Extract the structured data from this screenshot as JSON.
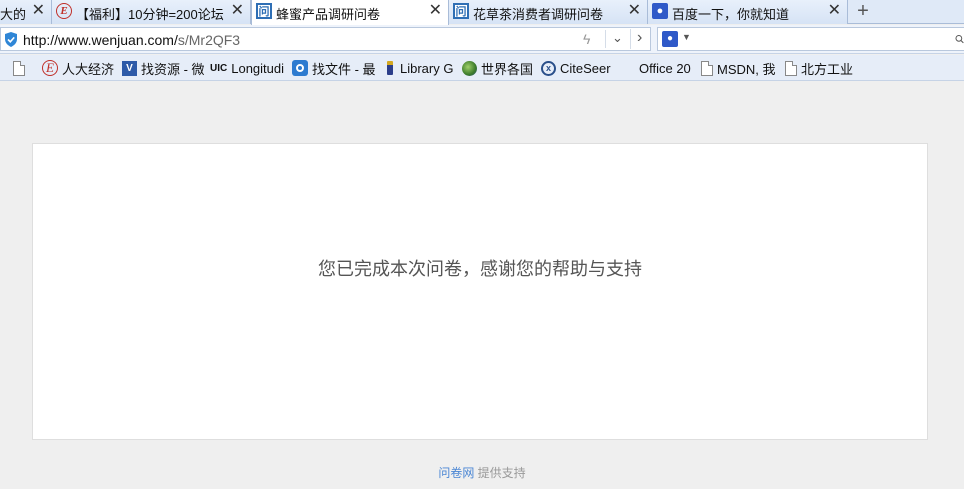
{
  "tabs": [
    {
      "title": "大的",
      "favicon": "none",
      "active": false
    },
    {
      "title": "【福利】10分钟=200论坛",
      "favicon": "e-forum-icon",
      "active": false
    },
    {
      "title": "蜂蜜产品调研问卷",
      "favicon": "wenjuan-icon",
      "active": true
    },
    {
      "title": "花草茶消费者调研问卷",
      "favicon": "wenjuan-icon",
      "active": false
    },
    {
      "title": "百度一下，你就知道",
      "favicon": "baidu-paw-icon",
      "active": false
    }
  ],
  "tab_close_glyph": "✕",
  "new_tab_glyph": "+",
  "address": {
    "url_host": "http://www.wenjuan.com/",
    "url_path": "s/Mr2QF3",
    "lightning_glyph": "ϟ",
    "dropdown_glyph": "⌄",
    "forward_glyph": "›"
  },
  "search": {
    "engine_glyph": "🐾",
    "engine_dropdown_glyph": "▼"
  },
  "bookmarks": [
    {
      "label": "",
      "icon": "page-icon"
    },
    {
      "label": "人大经济",
      "icon": "e-forum-icon"
    },
    {
      "label": "找资源 - 微",
      "icon": "v-icon"
    },
    {
      "label": "Longitudi",
      "icon": "uic-icon",
      "icon_text": "UIC"
    },
    {
      "label": "找文件 - 最",
      "icon": "target-icon"
    },
    {
      "label": "Library G",
      "icon": "library-icon"
    },
    {
      "label": "世界各国",
      "icon": "globe-icon"
    },
    {
      "label": "CiteSeer",
      "icon": "citeseer-icon"
    },
    {
      "label": "Office 20",
      "icon": "office-icon"
    },
    {
      "label": "MSDN, 我",
      "icon": "page-icon"
    },
    {
      "label": "北方工业",
      "icon": "page-icon"
    }
  ],
  "content": {
    "message": "您已完成本次问卷，感谢您的帮助与支持",
    "footer_link": "问卷网",
    "footer_text": " 提供支持"
  },
  "colors": {
    "accent": "#2f6fb5",
    "footer_link": "#4a86d4",
    "page_bg": "#efefef"
  }
}
